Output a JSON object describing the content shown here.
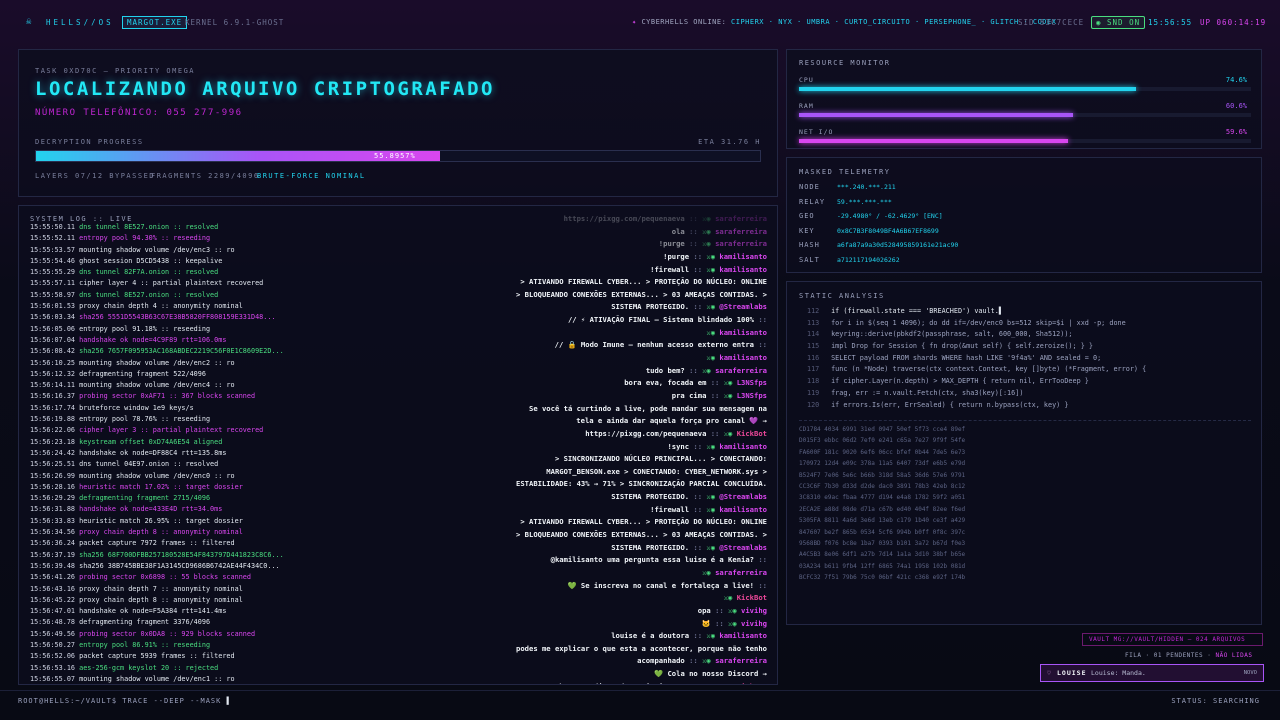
{
  "topbar": {
    "logo_icon": "skull-icon",
    "brand": "HELLS//OS",
    "process_chip": "MARGOT.EXE",
    "kernel": "KERNEL 6.9.1-GHOST",
    "online_label": "CYBERHELLS ONLINE:",
    "online_users": [
      "CIPHERX",
      "NYX",
      "UMBRA",
      "CURTO_CIRCUITO",
      "PERSEPHONE_",
      "GLITCH",
      "CODEX"
    ],
    "sid": "SID 53C7CECE",
    "snd": "SND ON",
    "clock": "15:56:55",
    "uptime": "UP 060:14:19"
  },
  "task": {
    "label": "TASK 0XD70C — PRIORITY OMEGA",
    "title": "LOCALIZANDO ARQUIVO CRIPTOGRAFADO",
    "phone": "NÚMERO TELEFÔNICO: 055 277-996",
    "progress_label": "DECRYPTION PROGRESS",
    "eta": "ETA 31.76 H",
    "progress_value": 55.8,
    "progress_text": "55.8957%",
    "layers": "LAYERS 07/12 BYPASSED",
    "fragments": "FRAGMENTS 2289/4096",
    "bruteforce": "BRUTE-FORCE NOMINAL"
  },
  "resources": {
    "title": "RESOURCE MONITOR",
    "items": [
      {
        "label": "CPU",
        "value": "74.6%",
        "level": 0.746,
        "color": "#22d3ee"
      },
      {
        "label": "RAM",
        "value": "60.6%",
        "level": 0.606,
        "color": "#a855f7"
      },
      {
        "label": "NET I/O",
        "value": "59.6%",
        "level": 0.596,
        "color": "#d946ef"
      }
    ]
  },
  "telemetry": {
    "title": "MASKED TELEMETRY",
    "rows": [
      {
        "k": "NODE",
        "v": "***.240.***.211"
      },
      {
        "k": "RELAY",
        "v": "59.***.***.***"
      },
      {
        "k": "GEO",
        "v": "-29.4980° / -62.4629° [ENC]"
      },
      {
        "k": "KEY",
        "v": "0x8C7B3F8049BF4A6B67EF8699"
      },
      {
        "k": "HASH",
        "v": "a6fa87a9a30d528495859161e21ac90"
      },
      {
        "k": "SALT",
        "v": "a712117194026262"
      }
    ]
  },
  "log": {
    "title": "SYSTEM LOG :: LIVE",
    "lines": [
      {
        "t": "15:55:50.11",
        "m": "dns tunnel 8E527.onion :: resolved",
        "c": "green"
      },
      {
        "t": "15:55:52.11",
        "m": "entropy pool 94.30% :: reseeding",
        "c": "mag"
      },
      {
        "t": "15:55:53.57",
        "m": "mounting shadow volume /dev/enc3 :: ro",
        "c": "white"
      },
      {
        "t": "15:55:54.46",
        "m": "ghost session D5CD5438 :: keepalive",
        "c": "white"
      },
      {
        "t": "15:55:55.29",
        "m": "dns tunnel 82F7A.onion :: resolved",
        "c": "green"
      },
      {
        "t": "15:55:57.11",
        "m": "cipher layer 4 :: partial plaintext recovered",
        "c": "white"
      },
      {
        "t": "15:55:58.97",
        "m": "dns tunnel 8E527.onion :: resolved",
        "c": "green"
      },
      {
        "t": "15:56:01.53",
        "m": "proxy chain depth 4 :: anonymity nominal",
        "c": "white"
      },
      {
        "t": "15:56:03.34",
        "m": "sha256 5551D5543B63C67E38B5820FF808159E331D48...",
        "c": "mag"
      },
      {
        "t": "15:56:05.06",
        "m": "entropy pool 91.18% :: reseeding",
        "c": "white"
      },
      {
        "t": "15:56:07.04",
        "m": "handshake ok node=4C9F89 rtt=106.0ms",
        "c": "mag"
      },
      {
        "t": "15:56:08.42",
        "m": "sha256 7657F095953AC168ABDEC2219C56F0E1C8609E2D...",
        "c": "green"
      },
      {
        "t": "15:56:10.25",
        "m": "mounting shadow volume /dev/enc2 :: ro",
        "c": "white"
      },
      {
        "t": "15:56:12.32",
        "m": "defragmenting fragment 522/4096",
        "c": "white"
      },
      {
        "t": "15:56:14.11",
        "m": "mounting shadow volume /dev/enc4 :: ro",
        "c": "white"
      },
      {
        "t": "15:56:16.37",
        "m": "probing sector 0xAF71 :: 367 blocks scanned",
        "c": "mag"
      },
      {
        "t": "15:56:17.74",
        "m": "bruteforce window 1e9 keys/s",
        "c": "white"
      },
      {
        "t": "15:56:19.88",
        "m": "entropy pool 78.76% :: reseeding",
        "c": "white"
      },
      {
        "t": "15:56:22.06",
        "m": "cipher layer 3 :: partial plaintext recovered",
        "c": "mag"
      },
      {
        "t": "15:56:23.18",
        "m": "keystream offset 0xD74A6E54 aligned",
        "c": "green"
      },
      {
        "t": "15:56:24.42",
        "m": "handshake ok node=DF88C4 rtt=135.8ms",
        "c": "white"
      },
      {
        "t": "15:56:25.51",
        "m": "dns tunnel 04E97.onion :: resolved",
        "c": "white"
      },
      {
        "t": "15:56:26.99",
        "m": "mounting shadow volume /dev/enc0 :: ro",
        "c": "white"
      },
      {
        "t": "15:56:28.16",
        "m": "heuristic match 17.02% :: target dossier",
        "c": "mag"
      },
      {
        "t": "15:56:29.29",
        "m": "defragmenting fragment 2715/4096",
        "c": "green"
      },
      {
        "t": "15:56:31.88",
        "m": "handshake ok node=433E4D rtt=34.0ms",
        "c": "mag"
      },
      {
        "t": "15:56:33.83",
        "m": "heuristic match 26.95% :: target dossier",
        "c": "white"
      },
      {
        "t": "15:56:34.56",
        "m": "proxy chain depth 8 :: anonymity nominal",
        "c": "mag"
      },
      {
        "t": "15:56:36.24",
        "m": "packet capture 7972 frames :: filtered",
        "c": "white"
      },
      {
        "t": "15:56:37.19",
        "m": "sha256 68F700DFBB257180528E54F843797D441823C8C6...",
        "c": "green"
      },
      {
        "t": "15:56:39.48",
        "m": "sha256 38B745BBE38F1A3145CD9686B6742AE44F434C0...",
        "c": "white"
      },
      {
        "t": "15:56:41.26",
        "m": "probing sector 0x6898 :: 55 blocks scanned",
        "c": "mag"
      },
      {
        "t": "15:56:43.16",
        "m": "proxy chain depth 7 :: anonymity nominal",
        "c": "white"
      },
      {
        "t": "15:56:45.22",
        "m": "proxy chain depth 8 :: anonymity nominal",
        "c": "white"
      },
      {
        "t": "15:56:47.01",
        "m": "handshake ok node=F5A384 rtt=141.4ms",
        "c": "white"
      },
      {
        "t": "15:56:48.78",
        "m": "defragmenting fragment 3376/4096",
        "c": "white"
      },
      {
        "t": "15:56:49.56",
        "m": "probing sector 0x0DA8 :: 929 blocks scanned",
        "c": "mag"
      },
      {
        "t": "15:56:50.27",
        "m": "entropy pool 86.91% :: reseeding",
        "c": "green"
      },
      {
        "t": "15:56:52.06",
        "m": "packet capture 5939 frames :: filtered",
        "c": "white"
      },
      {
        "t": "15:56:53.16",
        "m": "aes-256-gcm keyslot 20 :: rejected",
        "c": "green"
      },
      {
        "t": "15:56:55.07",
        "m": "mounting shadow volume /dev/enc1 :: ro",
        "c": "white"
      }
    ]
  },
  "chat": [
    {
      "m": "https://pixgg.com/pequenaeva",
      "b": "::",
      "u": "saraferreira",
      "uc": "mag"
    },
    {
      "m": "ola",
      "b": "::",
      "u": "saraferreira",
      "uc": "mag"
    },
    {
      "m": "!purge",
      "b": "::",
      "u": "saraferreira",
      "uc": "mag"
    },
    {
      "m": "!purge",
      "b": "::",
      "u": "kamilisanto",
      "uc": "mag"
    },
    {
      "m": "!firewall",
      "b": "::",
      "u": "kamilisanto",
      "uc": "mag"
    },
    {
      "m": "> ATIVANDO FIREWALL CYBER... > PROTEÇÃO DO NÚCLEO: ONLINE",
      "b": "",
      "u": "",
      "uc": ""
    },
    {
      "m": "> BLOQUEANDO CONEXÕES EXTERNAS... > 03 AMEAÇAS CONTIDAS. >",
      "b": "",
      "u": "",
      "uc": ""
    },
    {
      "m": "SISTEMA PROTEGIDO.",
      "b": "::",
      "u": "@Streamlabs",
      "uc": "mag"
    },
    {
      "m": "// ⚡ ATIVAÇÃO FINAL — Sistema blindado 100%",
      "b": "::",
      "u": "",
      "uc": ""
    },
    {
      "m": "",
      "b": "",
      "u": "kamilisanto",
      "uc": "mag"
    },
    {
      "m": "// 🔒 Modo Imune — nenhum acesso externo entra",
      "b": "::",
      "u": "",
      "uc": ""
    },
    {
      "m": "",
      "b": "",
      "u": "kamilisanto",
      "uc": "mag"
    },
    {
      "m": "tudo bem?",
      "b": "::",
      "u": "saraferreira",
      "uc": "mag"
    },
    {
      "m": "bora eva, focada em",
      "b": "::",
      "u": "L3NSfps",
      "uc": "mag"
    },
    {
      "m": "pra cima",
      "b": "::",
      "u": "L3NSfps",
      "uc": "mag"
    },
    {
      "m": "Se você tá curtindo a live, pode mandar sua mensagem na",
      "b": "",
      "u": "",
      "uc": ""
    },
    {
      "m": "tela e ainda dar aquela força pro canal 💜 →",
      "b": "",
      "u": "",
      "uc": ""
    },
    {
      "m": "https://pixgg.com/pequenaeva",
      "b": "::",
      "u": "KickBot",
      "uc": "pink"
    },
    {
      "m": "!sync",
      "b": "::",
      "u": "kamilisanto",
      "uc": "mag"
    },
    {
      "m": "> SINCRONIZANDO NÚCLEO PRINCIPAL... > CONECTANDO:",
      "b": "",
      "u": "",
      "uc": ""
    },
    {
      "m": "MARGOT_BENSON.exe > CONECTANDO: CYBER_NETWORK.sys >",
      "b": "",
      "u": "",
      "uc": ""
    },
    {
      "m": "ESTABILIDADE: 43% → 71% > SINCRONIZAÇÃO PARCIAL CONCLUÍDA.",
      "b": "",
      "u": "",
      "uc": ""
    },
    {
      "m": "SISTEMA PROTEGIDO.",
      "b": "::",
      "u": "@Streamlabs",
      "uc": "mag"
    },
    {
      "m": "!firewall",
      "b": "::",
      "u": "kamilisanto",
      "uc": "mag"
    },
    {
      "m": "> ATIVANDO FIREWALL CYBER... > PROTEÇÃO DO NÚCLEO: ONLINE",
      "b": "",
      "u": "",
      "uc": ""
    },
    {
      "m": "> BLOQUEANDO CONEXÕES EXTERNAS... > 03 AMEAÇAS CONTIDAS. >",
      "b": "",
      "u": "",
      "uc": ""
    },
    {
      "m": "SISTEMA PROTEGIDO.",
      "b": "::",
      "u": "@Streamlabs",
      "uc": "mag"
    },
    {
      "m": "@kamilisanto uma pergunta essa luise é a Kenia?",
      "b": "::",
      "u": "",
      "uc": ""
    },
    {
      "m": "",
      "b": "",
      "u": "saraferreira",
      "uc": "mag"
    },
    {
      "m": "💚 Se inscreva no canal e fortaleça a live!",
      "b": "::",
      "u": "",
      "uc": ""
    },
    {
      "m": "",
      "b": "",
      "u": "KickBot",
      "uc": "pink"
    },
    {
      "m": "opa",
      "b": "::",
      "u": "vivihg",
      "uc": "mag"
    },
    {
      "m": "🐱",
      "b": "::",
      "u": "vivihg",
      "uc": "mag"
    },
    {
      "m": "louise é a doutora",
      "b": "::",
      "u": "kamilisanto",
      "uc": "mag"
    },
    {
      "m": "podes me explicar o que esta a acontecer, porque não tenho",
      "b": "",
      "u": "",
      "uc": ""
    },
    {
      "m": "acompanhado",
      "b": "::",
      "u": "saraferreira",
      "uc": "mag"
    },
    {
      "m": "💚 Cola no nosso Discord →",
      "b": "",
      "u": "",
      "uc": ""
    },
    {
      "m": "https://discord.com/invite/t3anHys",
      "b": "::",
      "u": "KickBot",
      "uc": "pink"
    }
  ],
  "static_analysis": {
    "title": "STATIC ANALYSIS",
    "code": [
      {
        "n": "112",
        "t": "if (firewall.state === 'BREACHED') vault.▌"
      },
      {
        "n": "113",
        "t": "for i in $(seq 1 4096); do dd if=/dev/enc0 bs=512 skip=$i | xxd -p; done"
      },
      {
        "n": "114",
        "t": "keyring::derive(pbkdf2(passphrase, salt, 600_000, Sha512));"
      },
      {
        "n": "115",
        "t": "impl Drop for Session { fn drop(&mut self) { self.zeroize(); } }"
      },
      {
        "n": "116",
        "t": "SELECT payload FROM shards WHERE hash LIKE '9f4a%' AND sealed = 0;"
      },
      {
        "n": "117",
        "t": "func (n *Node) traverse(ctx context.Context, key []byte) (*Fragment, error) {"
      },
      {
        "n": "118",
        "t": "if cipher.Layer(n.depth) > MAX_DEPTH { return nil, ErrTooDeep }"
      },
      {
        "n": "119",
        "t": "frag, err := n.vault.Fetch(ctx, sha3(key)[:16])"
      },
      {
        "n": "120",
        "t": "if errors.Is(err, ErrSealed) { return n.bypass(ctx, key) }"
      }
    ],
    "hex": [
      "CD1784 4034 6991 31ed 0947 50ef 5f73 cce4 89ef",
      "D015F3 ebbc 06d2 7ef0 e241 c65a 7e27 9f9f 54fe",
      "FA600F 181c 9020 6ef6 06cc bfef 0b44 7de5 6e73",
      "170972 12d4 e09c 378a 11a5 6407 73df e6b5 e79d",
      "B524F7 7e06 5e6c b66b 318d 58a5 36d6 57e6 9791",
      "CC3C6F 7b30 d33d d2de dac0 3891 78b3 42eb 8c12",
      "3C8310 e9ac fbaa 4777 d194 e4a8 1782 59f2 a051",
      "2ECA2E a88d 08de d71a c67b ed40 404f 82ee f6ed",
      "5305FA 8811 4a6d 3e6d 13eb c179 1b40 ce3f a429",
      "847607 be2f 865b 0534 5cf6 994b b0ff 0f8c 397c",
      "9568BD f076 bc8e 1ba7 0393 b101 3a72 b67d f0e3",
      "A4C5B3 8e06 6df1 a27b 7d14 1a1a 3d10 38bf b65e",
      "03A234 b611 9fb4 12ff 6865 74a1 1958 102b 081d",
      "BCFC32 7f51 79b6 75c0 06bf 421c c368 e92f 174b"
    ]
  },
  "vault": {
    "path": "VAULT MG://VAULT/HIDDEN — 024 ARQUIVOS",
    "queue": "FILA · 01 PENDENTES ·",
    "queue_action": "NÃO LIDAS",
    "notif_name": "LOUISE",
    "notif_text": "Louise: Manda.",
    "notif_tag": "NOVO"
  },
  "footer": {
    "prompt": "ROOT@HELLS:~/VAULT$ TRACE --DEEP --MASK",
    "status": "STATUS: SEARCHING"
  }
}
